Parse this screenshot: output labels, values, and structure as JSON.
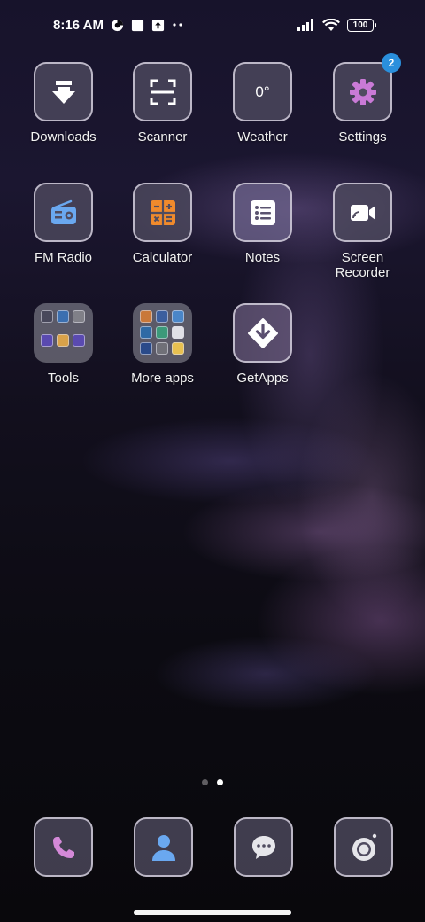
{
  "status_bar": {
    "time": "8:16 AM",
    "battery": "100",
    "left_icons": [
      "data-saver-icon",
      "square-notification-icon",
      "upload-notification-icon",
      "more-dots-icon"
    ],
    "right_icons": [
      "signal-icon",
      "wifi-icon",
      "battery-icon"
    ]
  },
  "apps": [
    {
      "label": "Downloads",
      "icon": "download-icon"
    },
    {
      "label": "Scanner",
      "icon": "scan-icon"
    },
    {
      "label": "Weather",
      "icon": "weather-icon",
      "value": "0°"
    },
    {
      "label": "Settings",
      "icon": "gear-icon",
      "badge": "2"
    },
    {
      "label": "FM Radio",
      "icon": "radio-icon"
    },
    {
      "label": "Calculator",
      "icon": "calculator-icon"
    },
    {
      "label": "Notes",
      "icon": "notes-icon"
    },
    {
      "label": "Screen Recorder",
      "icon": "screen-recorder-icon"
    },
    {
      "label": "Tools",
      "icon": "folder-icon"
    },
    {
      "label": "More apps",
      "icon": "folder-icon"
    },
    {
      "label": "GetApps",
      "icon": "getapps-icon"
    }
  ],
  "page_indicator": {
    "total": 2,
    "current": 2
  },
  "dock": [
    {
      "name": "phone",
      "icon": "phone-icon"
    },
    {
      "name": "contacts",
      "icon": "contacts-icon"
    },
    {
      "name": "messages",
      "icon": "chat-icon"
    },
    {
      "name": "camera",
      "icon": "camera-icon"
    }
  ],
  "colors": {
    "badge": "#2a8fdc",
    "radio": "#6aa8f0",
    "calculator": "#f08a2c",
    "settings": "#c97ad6",
    "phone": "#d489d8",
    "contacts": "#6aa8f0"
  }
}
